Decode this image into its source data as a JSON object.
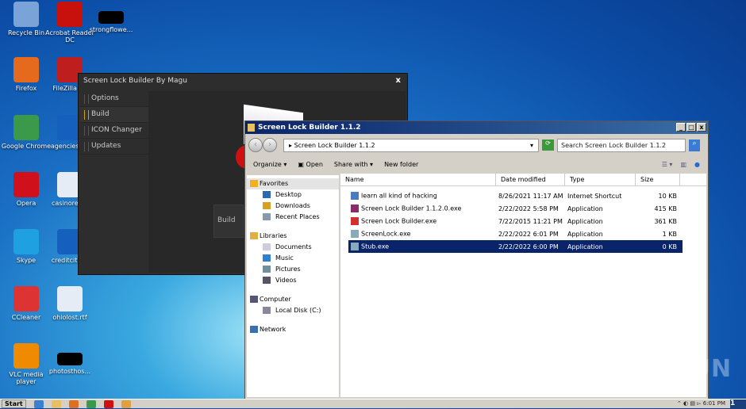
{
  "desktop_icons": [
    {
      "label": "Recycle Bin",
      "color": "#7aa4d8"
    },
    {
      "label": "Acrobat Reader DC",
      "color": "#c8100c"
    },
    {
      "label": "strongflowe...",
      "color": "#000000"
    },
    {
      "label": "Firefox",
      "color": "#e66a1e"
    },
    {
      "label": "FileZilla Cli",
      "color": "#bf1e1e"
    },
    {
      "label": "Google Chrome",
      "color": "#3a9a4a"
    },
    {
      "label": "agenciesmo",
      "color": "#1560bd"
    },
    {
      "label": "Opera",
      "color": "#d0101a"
    },
    {
      "label": "casinorequi",
      "color": "#e6ecf5"
    },
    {
      "label": "Skype",
      "color": "#1fa0e0"
    },
    {
      "label": "creditcities.",
      "color": "#1560bd"
    },
    {
      "label": "CCleaner",
      "color": "#d33"
    },
    {
      "label": "ohiolost.rtf",
      "color": "#e6ecf5"
    },
    {
      "label": "VLC media player",
      "color": "#f08a00"
    },
    {
      "label": "photosthos...",
      "color": "#000000"
    }
  ],
  "builder": {
    "title": "Screen Lock Builder By Magu",
    "close": "x",
    "menu": [
      "Options",
      "Build",
      "ICON Changer",
      "Updates"
    ],
    "active": "Build",
    "build_button": "Build"
  },
  "explorer": {
    "title": "Screen Lock Builder 1.1.2",
    "window_buttons": [
      "_",
      "□",
      "x"
    ],
    "address": "Screen Lock Builder 1.1.2",
    "search_placeholder": "Search Screen Lock Builder 1.1.2",
    "toolbar": {
      "organize": "Organize ▾",
      "open": "Open",
      "share": "Share with ▾",
      "new_folder": "New folder"
    },
    "nav": [
      {
        "label": "Favorites",
        "header": true,
        "color": "#f0b020"
      },
      {
        "label": "Desktop",
        "color": "#2a6ab0"
      },
      {
        "label": "Downloads",
        "color": "#d8a020"
      },
      {
        "label": "Recent Places",
        "color": "#8899aa"
      },
      {
        "label": "Libraries",
        "header": true,
        "color": "#e0b040",
        "gap": true
      },
      {
        "label": "Documents",
        "color": "#ccd"
      },
      {
        "label": "Music",
        "color": "#3080d0"
      },
      {
        "label": "Pictures",
        "color": "#7090a0"
      },
      {
        "label": "Videos",
        "color": "#556"
      },
      {
        "label": "Computer",
        "header": true,
        "color": "#557",
        "gap": true
      },
      {
        "label": "Local Disk (C:)",
        "color": "#889"
      },
      {
        "label": "Network",
        "header": true,
        "color": "#3a70b0",
        "gap": true
      }
    ],
    "columns": [
      "Name",
      "Date modified",
      "Type",
      "Size"
    ],
    "files": [
      {
        "name": "learn all kind of hacking",
        "date": "8/26/2021 11:17 AM",
        "type": "Internet Shortcut",
        "size": "10 KB",
        "color": "#4a7ac0"
      },
      {
        "name": "Screen Lock Builder 1.1.2.0.exe",
        "date": "2/22/2022 5:58 PM",
        "type": "Application",
        "size": "415 KB",
        "color": "#8a2a6a"
      },
      {
        "name": "Screen Lock Builder.exe",
        "date": "7/22/2015 11:21 PM",
        "type": "Application",
        "size": "361 KB",
        "color": "#d03030"
      },
      {
        "name": "ScreenLock.exe",
        "date": "2/22/2022 6:01 PM",
        "type": "Application",
        "size": "1 KB",
        "color": "#8ab"
      },
      {
        "name": "Stub.exe",
        "date": "2/22/2022 6:00 PM",
        "type": "Application",
        "size": "0 KB",
        "color": "#8ab",
        "selected": true
      }
    ]
  },
  "taskbar": {
    "start": "Start",
    "clock": "6:01 PM",
    "corner": "1"
  },
  "watermark": "ANY RUN"
}
